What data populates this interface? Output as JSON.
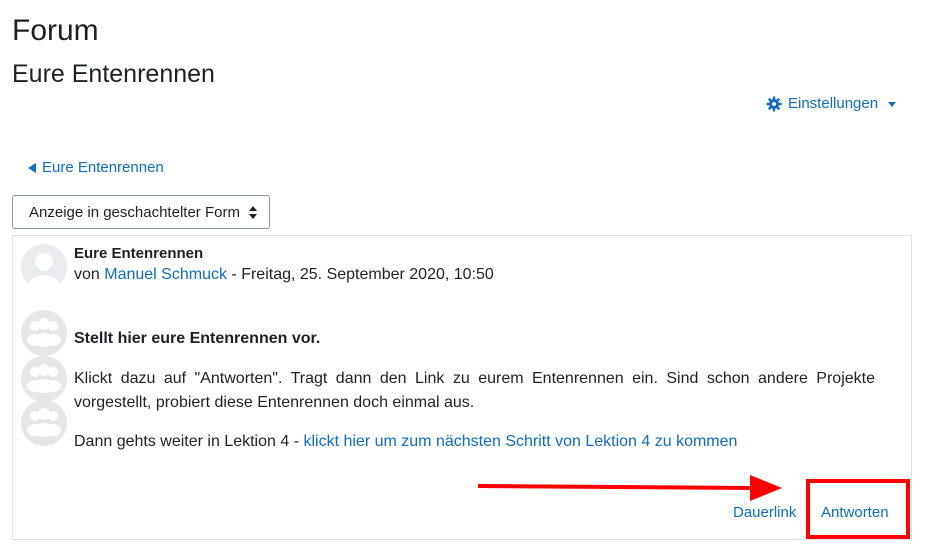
{
  "page": {
    "heading": "Forum",
    "subheading": "Eure Entenrennen"
  },
  "settings": {
    "label": "Einstellungen"
  },
  "nav": {
    "back_label": "Eure Entenrennen"
  },
  "display_mode": {
    "selected": "Anzeige in geschachtelter Form"
  },
  "post": {
    "title": "Eure Entenrennen",
    "by_prefix": "von",
    "author": "Manuel Schmuck",
    "date": "- Freitag, 25. September 2020, 10:50",
    "body_bold": "Stellt hier eure Entenrennen vor.",
    "body_paragraph": "Klickt dazu auf \"Antworten\". Tragt dann den Link zu eurem Entenrennen ein. Sind schon andere Projekte vorgestellt, probiert diese Entenrennen doch einmal aus.",
    "body_next_prefix": "Dann gehts weiter in Lektion 4 - ",
    "body_next_link": "klickt hier um zum nächsten Schritt von Lektion 4 zu kommen",
    "actions": {
      "permalink": "Dauerlink",
      "reply": "Antworten"
    }
  },
  "colors": {
    "link": "#0f6cbf",
    "annotation": "#ff0000",
    "border": "#dee2e6"
  },
  "icons": {
    "settings": "gear-icon",
    "back": "triangle-left-icon",
    "select": "sort-arrows-icon",
    "avatar": "user-avatar-icon",
    "group": "group-icon"
  }
}
